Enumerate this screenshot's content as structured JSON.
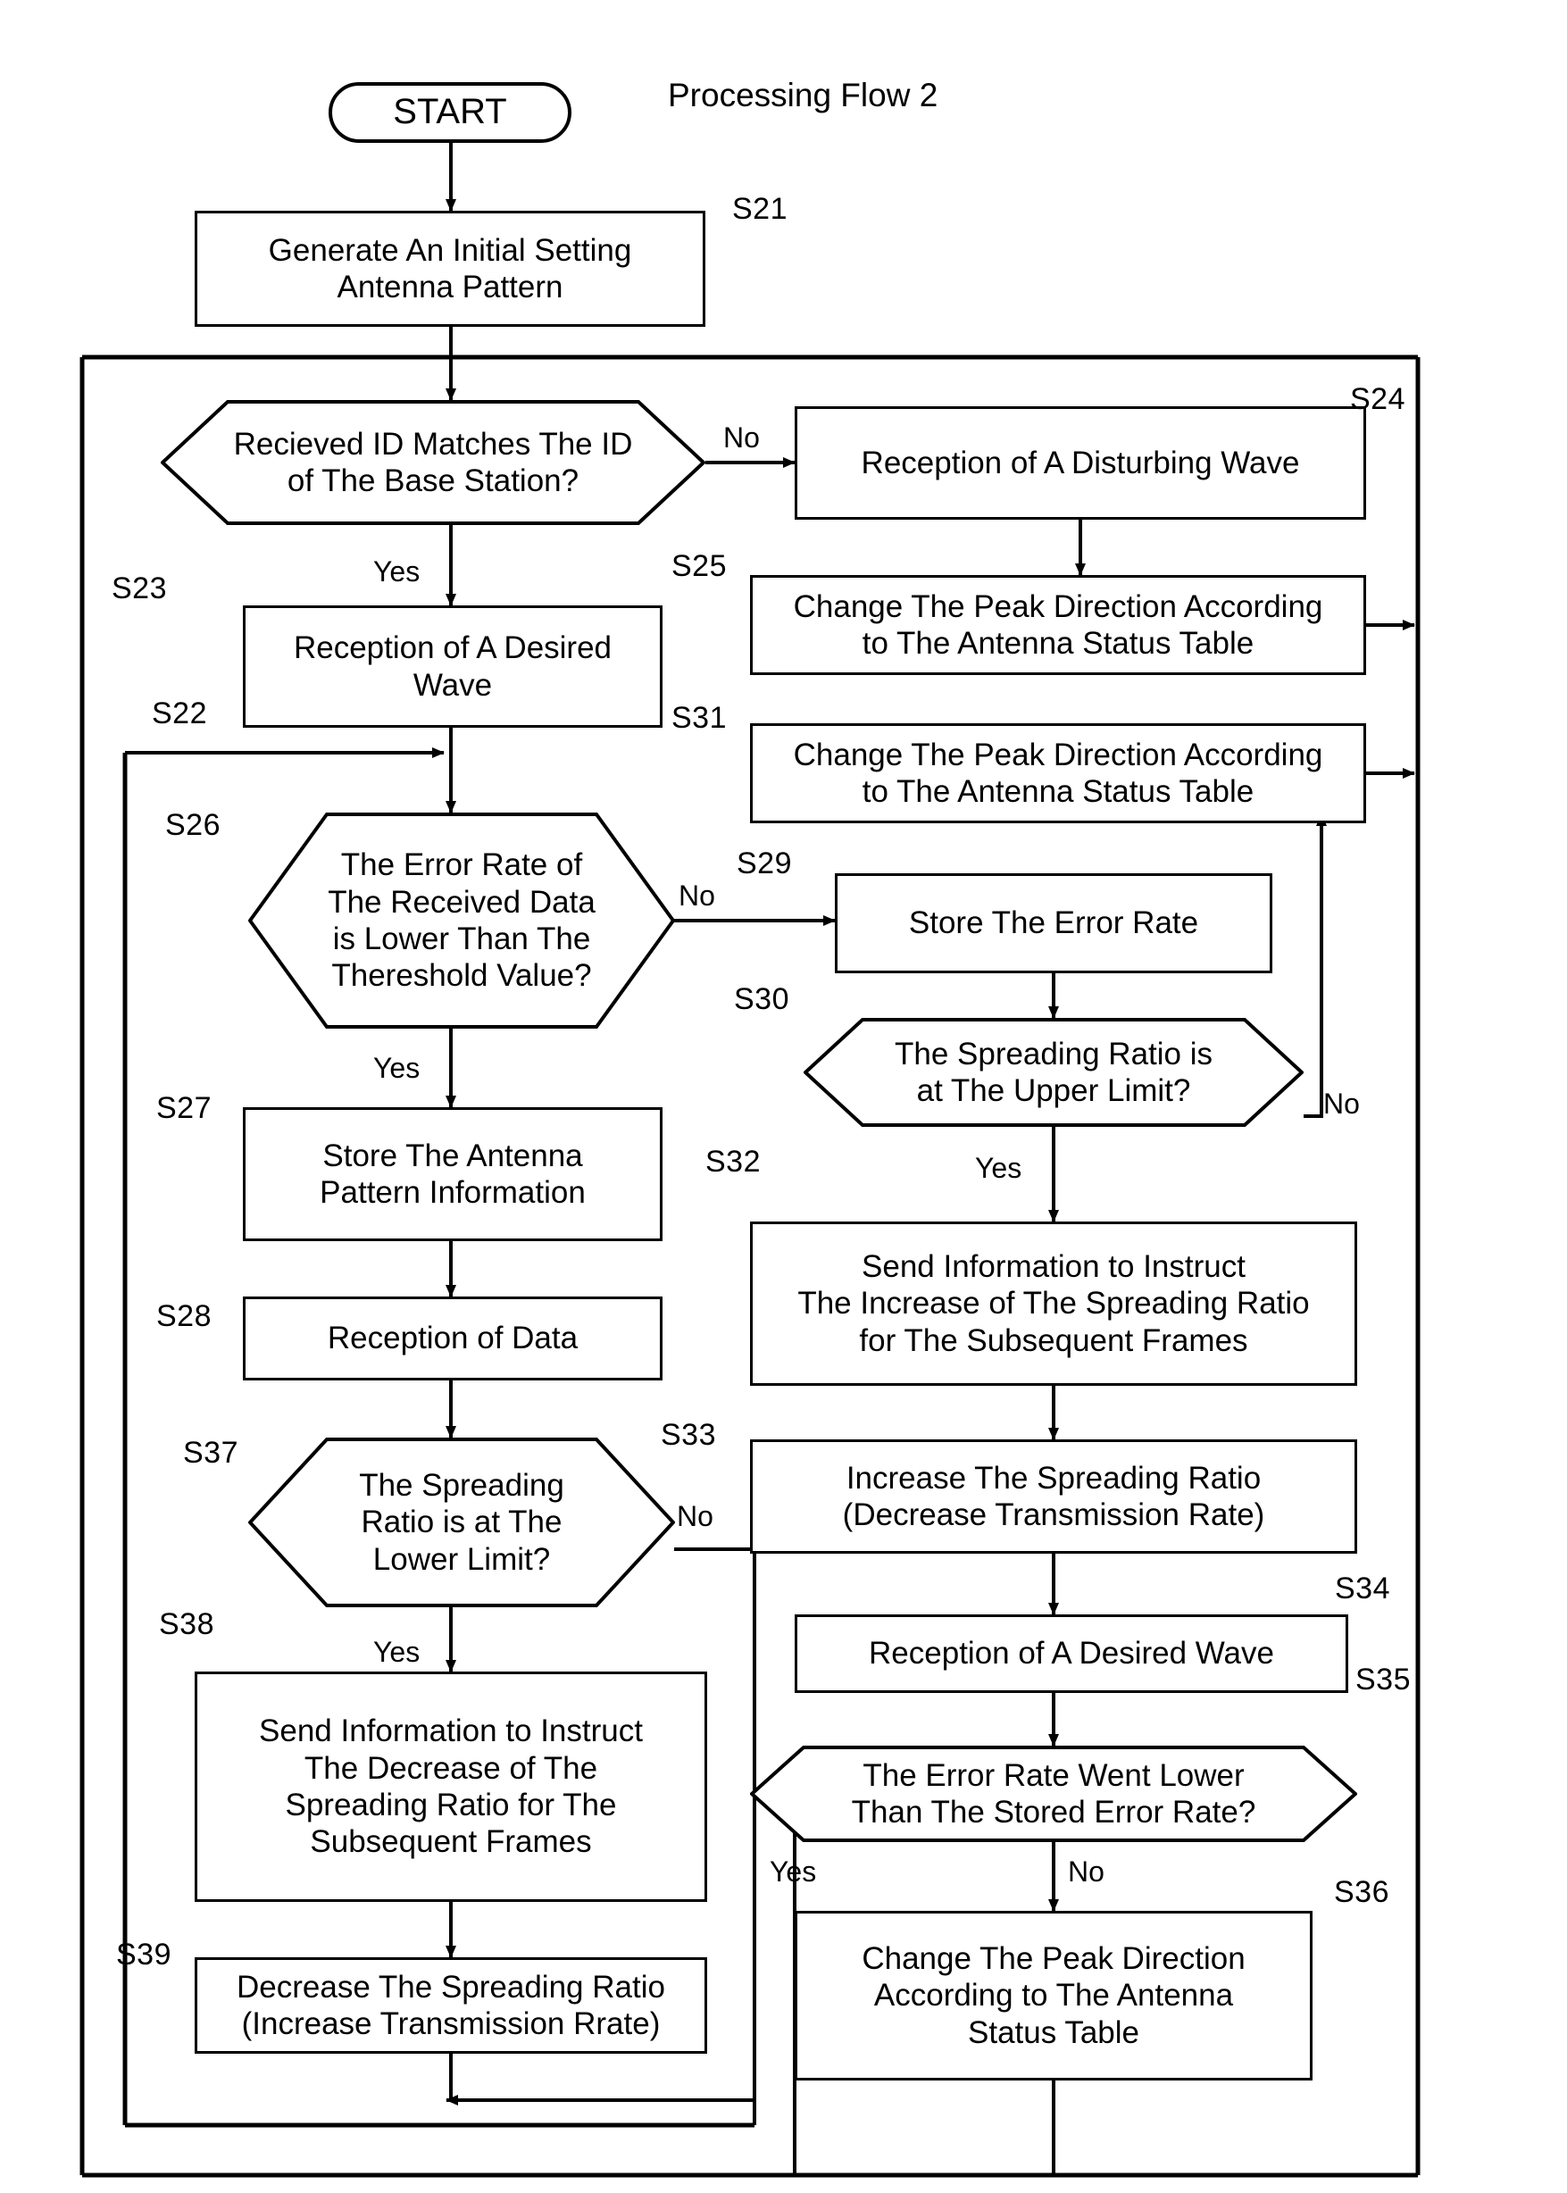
{
  "figure": {
    "title": "Processing  Flow 2"
  },
  "nodes": {
    "start": {
      "id": "",
      "text": "START"
    },
    "s21": {
      "id": "S21",
      "text": "Generate An Initial Setting\nAntenna Pattern"
    },
    "s23": {
      "id": "S23",
      "text": "Recieved ID Matches The ID\nof The Base Station?"
    },
    "s24": {
      "id": "S24",
      "text": "Reception of A Disturbing Wave"
    },
    "s25": {
      "id": "S25",
      "text": "Change The Peak Direction According\nto The Antenna Status Table"
    },
    "s22": {
      "id": "S22",
      "text": "Reception of A Desired\nWave"
    },
    "s31": {
      "id": "S31",
      "text": "Change The Peak Direction According\nto The Antenna Status Table"
    },
    "s26": {
      "id": "S26",
      "text": "The Error Rate of\nThe Received Data\nis Lower Than The\nThereshold Value?"
    },
    "s29": {
      "id": "S29",
      "text": "Store The Error Rate"
    },
    "s30": {
      "id": "S30",
      "text": "The Spreading Ratio is\nat The Upper Limit?"
    },
    "s27": {
      "id": "S27",
      "text": "Store The Antenna\nPattern Information"
    },
    "s32": {
      "id": "S32",
      "text": "Send Information to Instruct\nThe Increase of The Spreading Ratio\nfor The Subsequent Frames"
    },
    "s28": {
      "id": "S28",
      "text": "Reception of Data"
    },
    "s33": {
      "id": "S33",
      "text": "Increase The Spreading Ratio\n(Decrease Transmission Rate)"
    },
    "s37": {
      "id": "S37",
      "text": "The Spreading\nRatio is at The\nLower Limit?"
    },
    "s34": {
      "id": "S34",
      "text": "Reception of A Desired Wave"
    },
    "s35": {
      "id": "S35",
      "text": "The Error Rate Went Lower\nThan The Stored Error Rate?"
    },
    "s38": {
      "id": "S38",
      "text": "Send Information to Instruct\nThe Decrease of The\nSpreading Ratio for The\nSubsequent Frames"
    },
    "s36": {
      "id": "S36",
      "text": "Change The Peak Direction\nAccording to The Antenna\nStatus Table"
    },
    "s39": {
      "id": "S39",
      "text": "Decrease The Spreading Ratio\n(Increase Transmission Rrate)"
    }
  },
  "edge_labels": {
    "s23_no": "No",
    "s23_yes": "Yes",
    "s26_no": "No",
    "s26_yes": "Yes",
    "s30_no": "No",
    "s30_yes": "Yes",
    "s37_no": "No",
    "s37_yes": "Yes",
    "s35_yes": "Yes",
    "s35_no": "No"
  },
  "colors": {
    "stroke": "#000000",
    "background": "#ffffff"
  }
}
